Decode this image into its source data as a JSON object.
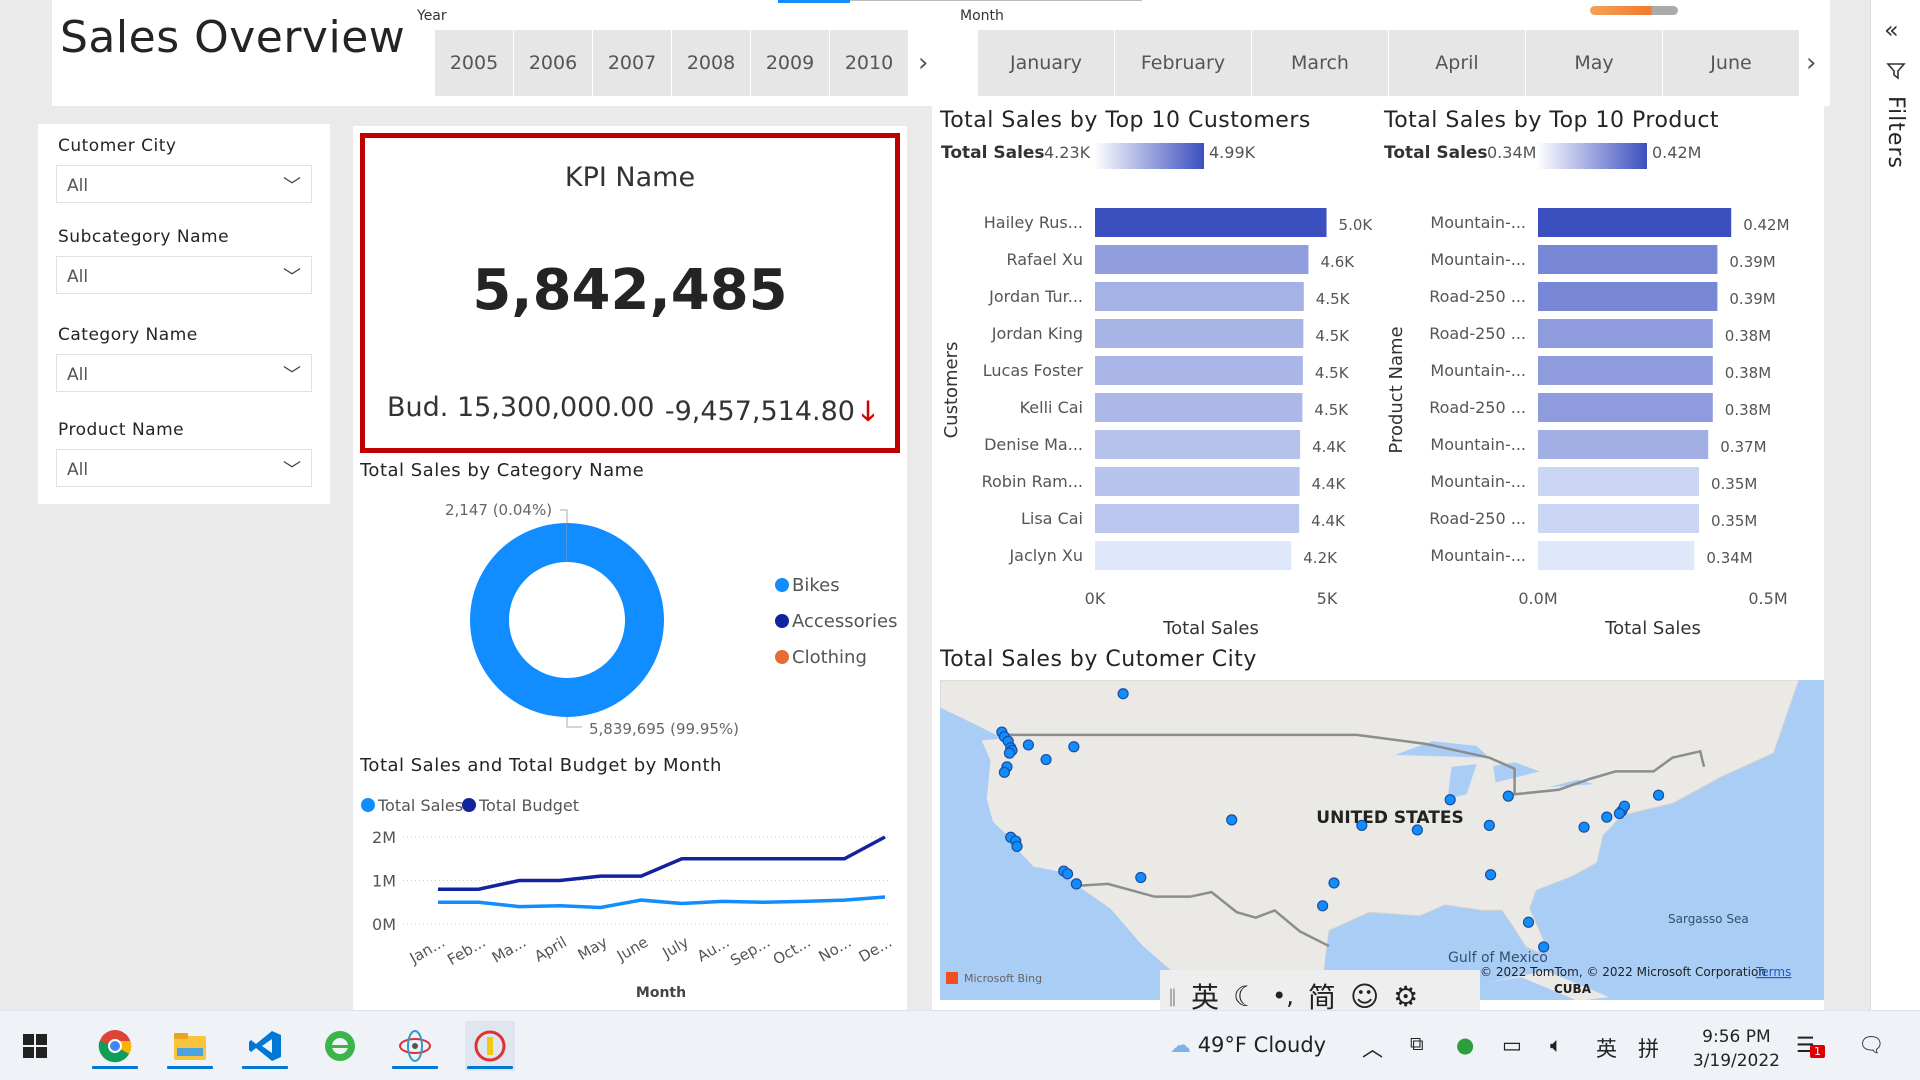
{
  "report": {
    "title": "Sales Overview",
    "year_slicer": {
      "label": "Year",
      "tiles": [
        "2005",
        "2006",
        "2007",
        "2008",
        "2009",
        "2010"
      ]
    },
    "month_slicer": {
      "label": "Month",
      "tiles": [
        "January",
        "February",
        "March",
        "April",
        "May",
        "June"
      ]
    }
  },
  "filters": [
    {
      "label": "Cutomer City",
      "value": "All"
    },
    {
      "label": "Subcategory Name",
      "value": "All"
    },
    {
      "label": "Category Name",
      "value": "All"
    },
    {
      "label": "Product Name",
      "value": "All"
    }
  ],
  "kpi": {
    "name": "KPI Name",
    "value": "5,842,485",
    "budget": "Bud. 15,300,000.00",
    "difference": "-9,457,514.80",
    "arrow": "🡓",
    "border_color": "#c00000"
  },
  "colors": {
    "accent": "#118dff",
    "dark_blue": "#12239e",
    "orange": "#e66c37",
    "kpi_red": "#c00000",
    "bar_max": "#3c4fbf",
    "bar_min": "#dfe8fb"
  },
  "side_panel": {
    "label": "Filters"
  },
  "ime": {
    "lang": "英",
    "mode": "简"
  },
  "taskbar": {
    "apps": [
      "windows-start-icon",
      "chrome-icon",
      "file-explorer-icon",
      "vscode-icon",
      "edge-icon",
      "app-icon",
      "power-bi-icon"
    ],
    "weather": "49°F  Cloudy",
    "tray_lang": "英",
    "tray_ime": "拼",
    "time": "9:56 PM",
    "date": "3/19/2022",
    "notification_count": "1"
  },
  "chart_data": [
    {
      "id": "customers",
      "type": "bar",
      "orientation": "horizontal",
      "title": "Total Sales by Top 10 Customers",
      "legend": {
        "label": "Total Sales",
        "min": "4.23K",
        "max": "4.99K"
      },
      "categories": [
        "Hailey Rus...",
        "Rafael Xu",
        "Jordan Tur...",
        "Jordan King",
        "Lucas Foster",
        "Kelli Cai",
        "Denise Ma...",
        "Robin Ram...",
        "Lisa Cai",
        "Jaclyn Xu"
      ],
      "values": [
        4990,
        4600,
        4500,
        4490,
        4480,
        4470,
        4420,
        4410,
        4400,
        4230
      ],
      "data_labels": [
        "5.0K",
        "4.6K",
        "4.5K",
        "4.5K",
        "4.5K",
        "4.5K",
        "4.4K",
        "4.4K",
        "4.4K",
        "4.2K"
      ],
      "xlabel": "Total Sales",
      "ylabel": "Customers",
      "xlim": [
        0,
        5000
      ],
      "xticks": [
        "0K",
        "5K"
      ]
    },
    {
      "id": "products",
      "type": "bar",
      "orientation": "horizontal",
      "title": "Total Sales by Top 10 Product",
      "legend": {
        "label": "Total Sales",
        "min": "0.34M",
        "max": "0.42M"
      },
      "categories": [
        "Mountain-...",
        "Mountain-...",
        "Road-250 ...",
        "Road-250 ...",
        "Mountain-...",
        "Road-250 ...",
        "Mountain-...",
        "Mountain-...",
        "Road-250 ...",
        "Mountain-..."
      ],
      "values": [
        0.42,
        0.39,
        0.39,
        0.38,
        0.38,
        0.38,
        0.37,
        0.35,
        0.35,
        0.34
      ],
      "data_labels": [
        "0.42M",
        "0.39M",
        "0.39M",
        "0.38M",
        "0.38M",
        "0.38M",
        "0.37M",
        "0.35M",
        "0.35M",
        "0.34M"
      ],
      "xlabel": "Total Sales",
      "ylabel": "Product Name",
      "xlim": [
        0,
        0.5
      ],
      "xticks": [
        "0.0M",
        "0.5M"
      ]
    },
    {
      "id": "category",
      "type": "pie",
      "variant": "donut",
      "title": "Total Sales by Category Name",
      "categories": [
        "Bikes",
        "Accessories",
        "Clothing"
      ],
      "values": [
        5839695,
        0,
        2147
      ],
      "data_labels": [
        "5,839,695 (99.95%)",
        "2,147 (0.04%)"
      ],
      "colors": [
        "#118dff",
        "#12239e",
        "#e66c37"
      ],
      "legend_position": "right"
    },
    {
      "id": "monthly",
      "type": "line",
      "title": "Total Sales and Total Budget by Month",
      "categories": [
        "Jan...",
        "Feb...",
        "Ma...",
        "April",
        "May",
        "June",
        "July",
        "Au...",
        "Sep...",
        "Oct...",
        "No...",
        "De..."
      ],
      "series": [
        {
          "name": "Total Sales",
          "color": "#118dff",
          "values": [
            500000,
            500000,
            400000,
            420000,
            380000,
            550000,
            470000,
            520000,
            500000,
            520000,
            550000,
            620000
          ]
        },
        {
          "name": "Total Budget",
          "color": "#12239e",
          "values": [
            800000,
            800000,
            1000000,
            1000000,
            1100000,
            1100000,
            1500000,
            1500000,
            1500000,
            1500000,
            1500000,
            2000000
          ]
        }
      ],
      "xlabel": "Month",
      "ylim": [
        0,
        2000000
      ],
      "yticks": [
        "0M",
        "1M",
        "2M"
      ],
      "legend_position": "top-left"
    },
    {
      "id": "map",
      "type": "scatter",
      "title": "Total Sales by Cutomer City",
      "map_labels": {
        "country": "UNITED STATES",
        "gulf": "Gulf of Mexico",
        "sea": "Sargasso Sea",
        "cuba": "CUBA"
      },
      "attribution": {
        "bing": "Microsoft Bing",
        "copyright": "© 2022 TomTom, © 2022 Microsoft Corporation",
        "terms": "Terms"
      },
      "points": [
        {
          "lon": -123.1,
          "lat": 49.3
        },
        {
          "lon": -122.9,
          "lat": 48.8
        },
        {
          "lon": -122.6,
          "lat": 48.3
        },
        {
          "lon": -122.4,
          "lat": 47.6
        },
        {
          "lon": -122.3,
          "lat": 47.3
        },
        {
          "lon": -122.5,
          "lat": 47.0
        },
        {
          "lon": -122.7,
          "lat": 45.5
        },
        {
          "lon": -122.9,
          "lat": 44.9
        },
        {
          "lon": -117.4,
          "lat": 47.7
        },
        {
          "lon": -119.6,
          "lat": 46.3
        },
        {
          "lon": -121.0,
          "lat": 47.9
        },
        {
          "lon": -113.5,
          "lat": 53.5
        },
        {
          "lon": -122.4,
          "lat": 37.8
        },
        {
          "lon": -122.0,
          "lat": 37.4
        },
        {
          "lon": -121.9,
          "lat": 36.8
        },
        {
          "lon": -118.2,
          "lat": 34.1
        },
        {
          "lon": -117.9,
          "lat": 33.8
        },
        {
          "lon": -117.2,
          "lat": 32.7
        },
        {
          "lon": -112.1,
          "lat": 33.4
        },
        {
          "lon": -104.9,
          "lat": 39.7
        },
        {
          "lon": -97.7,
          "lat": 30.3
        },
        {
          "lon": -96.8,
          "lat": 32.8
        },
        {
          "lon": -90.2,
          "lat": 38.6
        },
        {
          "lon": -94.6,
          "lat": 39.1
        },
        {
          "lon": -87.6,
          "lat": 41.9
        },
        {
          "lon": -84.4,
          "lat": 33.7
        },
        {
          "lon": -81.4,
          "lat": 28.5
        },
        {
          "lon": -80.2,
          "lat": 25.8
        },
        {
          "lon": -77.0,
          "lat": 38.9
        },
        {
          "lon": -75.2,
          "lat": 40.0
        },
        {
          "lon": -74.0,
          "lat": 40.7
        },
        {
          "lon": -73.8,
          "lat": 41.2
        },
        {
          "lon": -71.1,
          "lat": 42.4
        },
        {
          "lon": -83.0,
          "lat": 42.3
        },
        {
          "lon": -84.5,
          "lat": 39.1
        },
        {
          "lon": -74.2,
          "lat": 40.4
        }
      ]
    }
  ]
}
